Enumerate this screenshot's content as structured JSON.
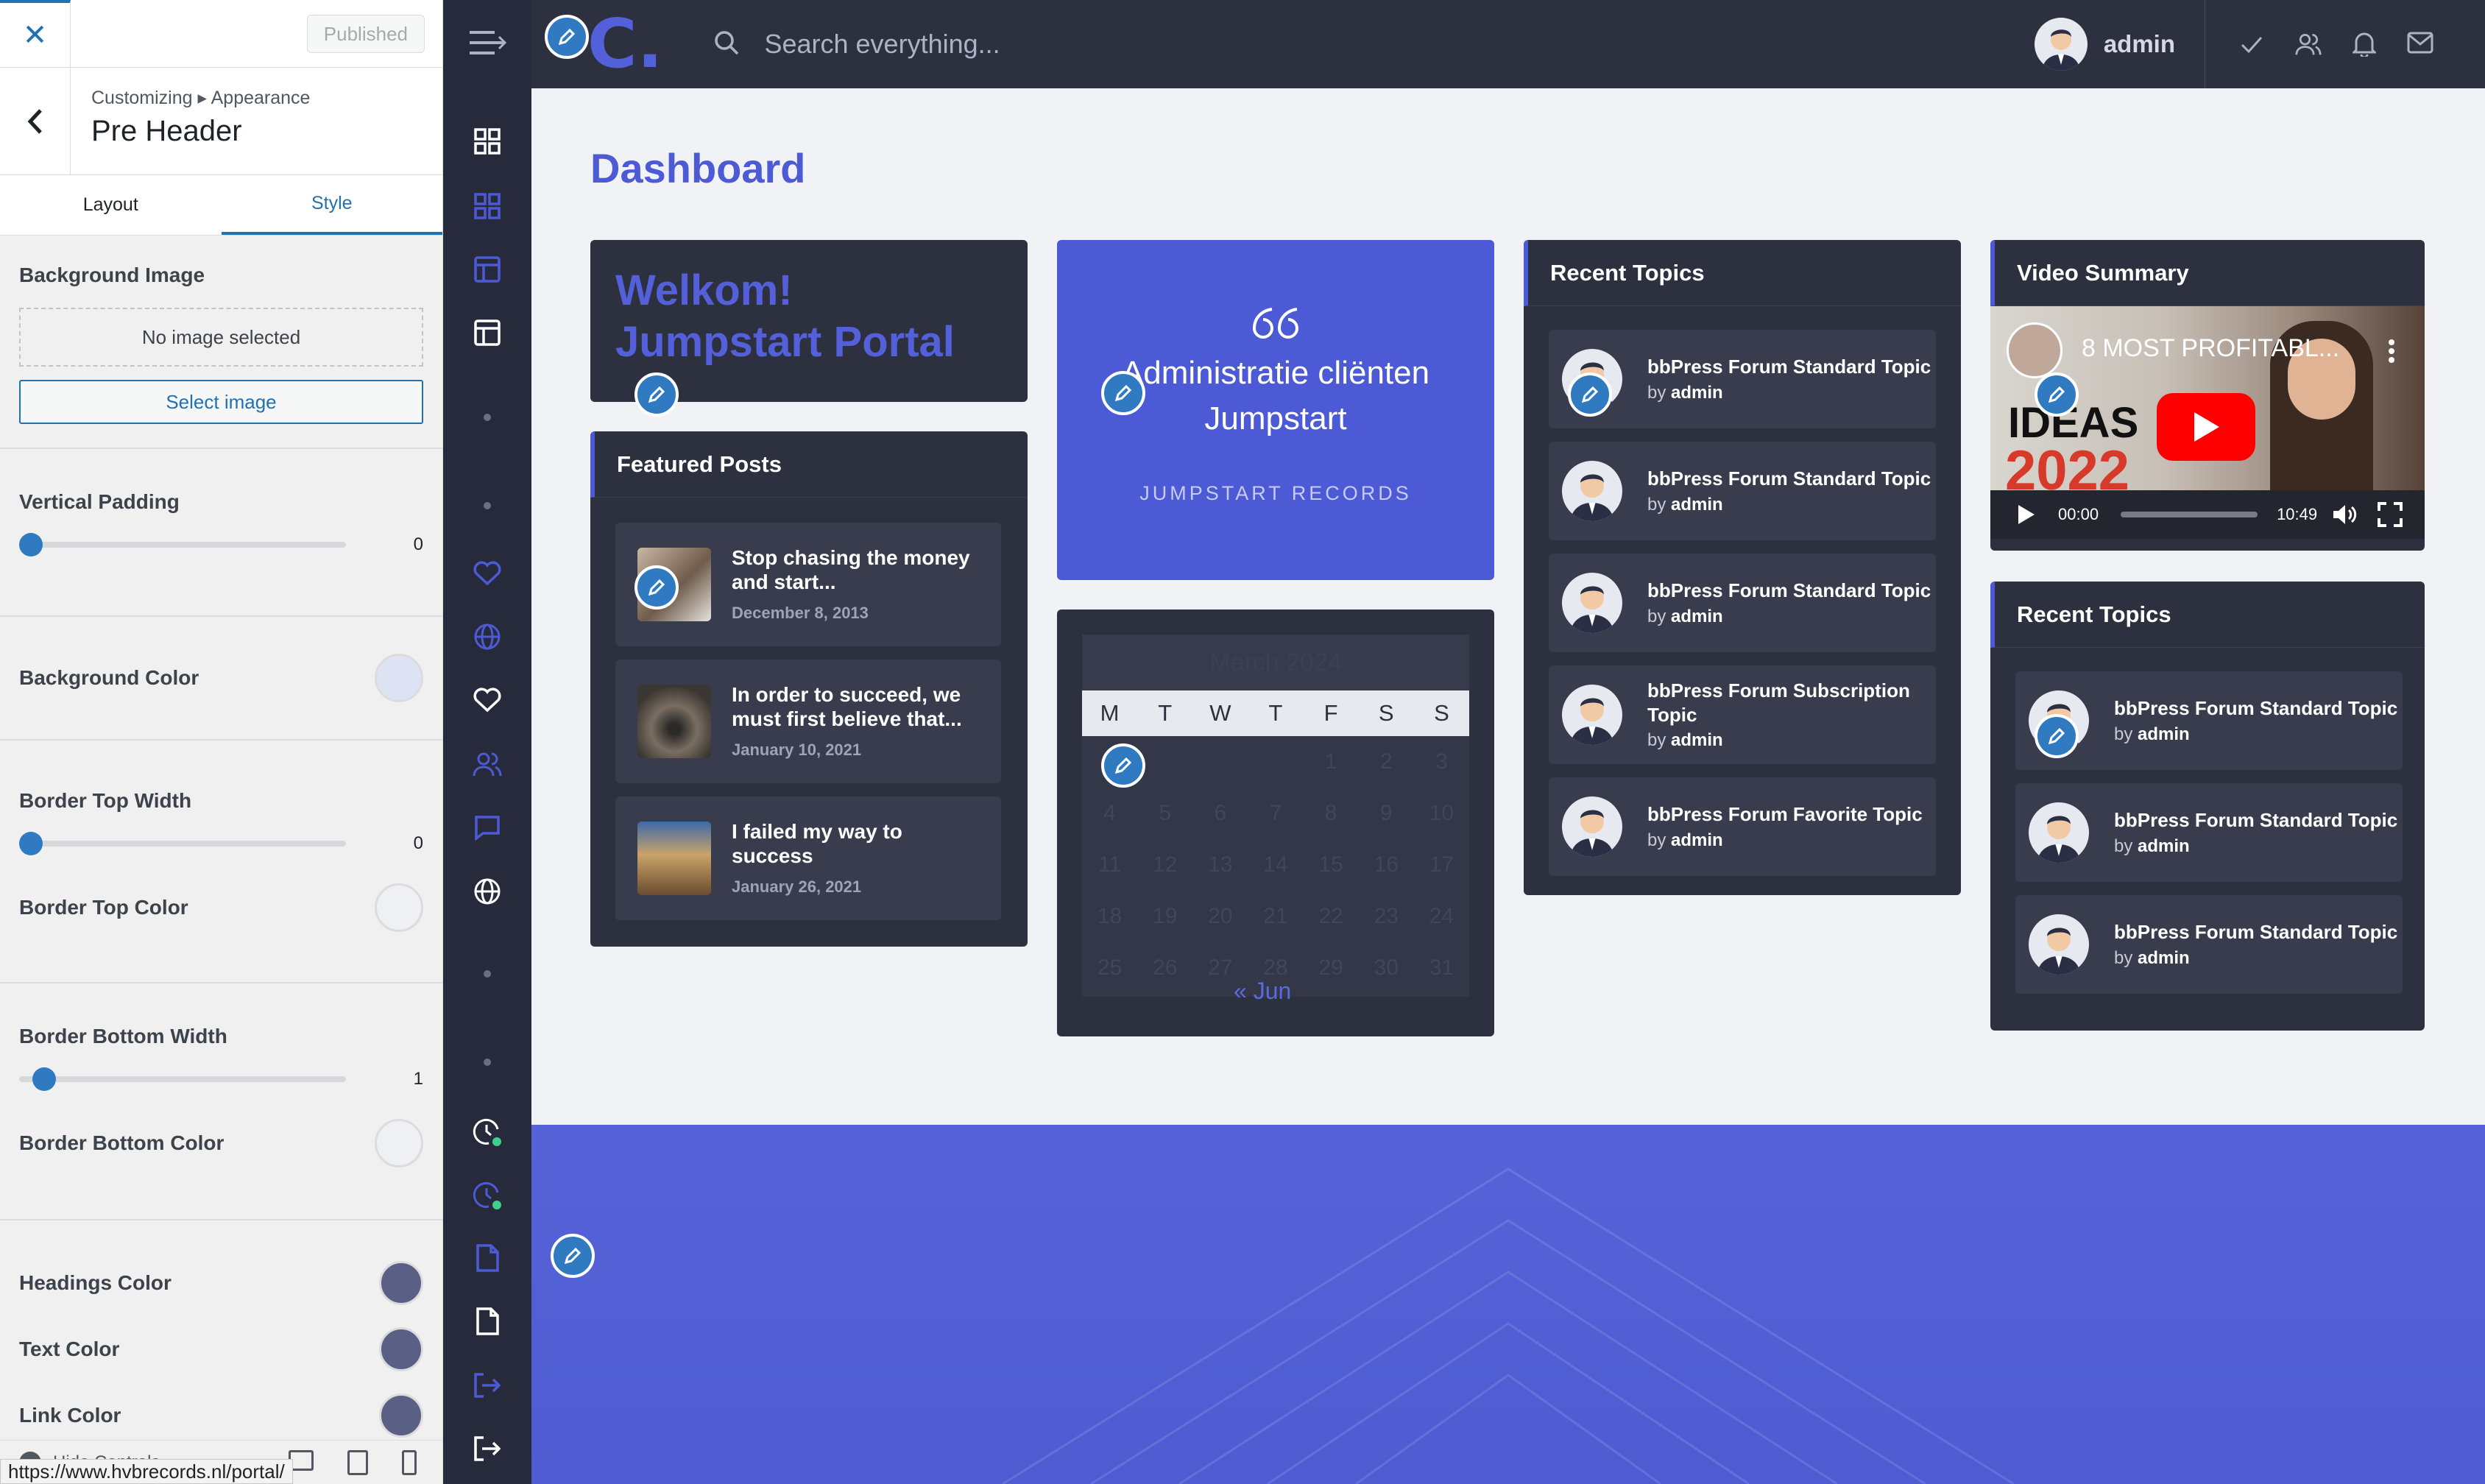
{
  "customizer": {
    "close_label": "✕",
    "published_label": "Published",
    "back_label": "‹",
    "breadcrumb": "Customizing ▸ Appearance",
    "panel_title": "Pre Header",
    "tabs": [
      {
        "label": "Layout"
      },
      {
        "label": "Style"
      }
    ],
    "background_image": {
      "label": "Background Image",
      "placeholder": "No image selected",
      "button": "Select image"
    },
    "vertical_padding": {
      "label": "Vertical Padding",
      "value": "0"
    },
    "background_color": {
      "label": "Background Color",
      "color": "#dde3f3"
    },
    "border_top_width": {
      "label": "Border Top Width",
      "value": "0"
    },
    "border_top_color": {
      "label": "Border Top Color",
      "color": "#eef0f2"
    },
    "border_bottom_width": {
      "label": "Border Bottom Width",
      "value": "1"
    },
    "border_bottom_color": {
      "label": "Border Bottom Color",
      "color": "#eef0f2"
    },
    "headings_color": {
      "label": "Headings Color",
      "color": "#5a6085"
    },
    "text_color": {
      "label": "Text Color",
      "color": "#5a6085"
    },
    "link_color": {
      "label": "Link Color",
      "color": "#5a6085"
    },
    "hide_controls": "Hide Controls"
  },
  "status_bar_url": "https://www.hvbrecords.nl/portal/",
  "topbar": {
    "logo": "C.",
    "search_placeholder": "Search everything...",
    "user_name": "admin"
  },
  "page_title": "Dashboard",
  "welcome": {
    "line1": "Welkom!",
    "line2": "Jumpstart Portal"
  },
  "featured_posts": {
    "title": "Featured Posts",
    "items": [
      {
        "title": "Stop chasing the money and start...",
        "date": "December 8, 2013"
      },
      {
        "title": "In order to succeed, we must first believe that...",
        "date": "January 10, 2021"
      },
      {
        "title": "I failed my way to success",
        "date": "January 26, 2021"
      }
    ]
  },
  "quote": {
    "text": "Administratie cliënten Jumpstart",
    "sub": "JUMPSTART RECORDS"
  },
  "calendar": {
    "month": "March 2024",
    "days": [
      "M",
      "T",
      "W",
      "T",
      "F",
      "S",
      "S"
    ],
    "dates": [
      "",
      "",
      "",
      "",
      "1",
      "2",
      "3",
      "4",
      "5",
      "6",
      "7",
      "8",
      "9",
      "10",
      "11",
      "12",
      "13",
      "14",
      "15",
      "16",
      "17",
      "18",
      "19",
      "20",
      "21",
      "22",
      "23",
      "24",
      "25",
      "26",
      "27",
      "28",
      "29",
      "30",
      "31"
    ],
    "prev_link": "« Jun"
  },
  "recent_topics": {
    "title": "Recent Topics",
    "by": "by",
    "items": [
      {
        "title": "bbPress Forum Standard Topic",
        "author": "admin"
      },
      {
        "title": "bbPress Forum Standard Topic",
        "author": "admin"
      },
      {
        "title": "bbPress Forum Standard Topic",
        "author": "admin"
      },
      {
        "title": "bbPress Forum Subscription Topic",
        "author": "admin"
      },
      {
        "title": "bbPress Forum Favorite Topic",
        "author": "admin"
      }
    ]
  },
  "video": {
    "title": "Video Summary",
    "video_title": "8 MOST PROFITABL...",
    "thumb_text": "IDEAS",
    "thumb_year": "2022",
    "time_current": "00:00",
    "time_total": "10:49"
  },
  "recent_topics_2": {
    "title": "Recent Topics",
    "by": "by",
    "items": [
      {
        "title": "bbPress Forum Standard Topic",
        "author": "admin"
      },
      {
        "title": "bbPress Forum Standard Topic",
        "author": "admin"
      },
      {
        "title": "bbPress Forum Standard Topic",
        "author": "admin"
      }
    ]
  },
  "colors": {
    "accent": "#4d5ad6",
    "dark": "#2d303f",
    "wp_blue": "#2271b1"
  }
}
